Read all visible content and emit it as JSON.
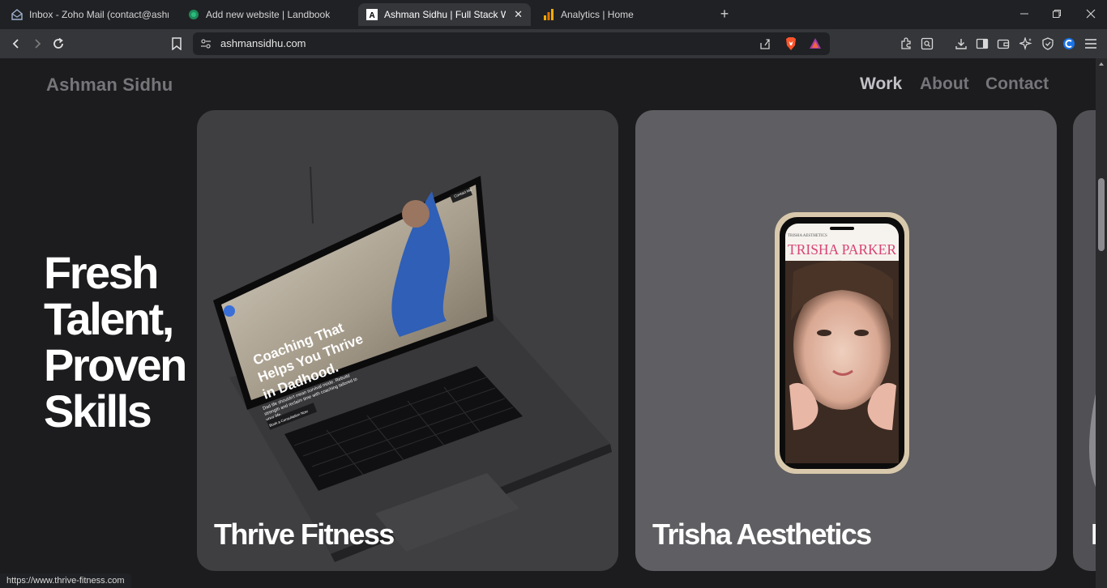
{
  "browser": {
    "tabs": [
      {
        "label": "Inbox - Zoho Mail (contact@ashmansidhu.com)",
        "icon": "mail-icon",
        "active": false
      },
      {
        "label": "Add new website | Landbook",
        "icon": "landbook-icon",
        "active": false
      },
      {
        "label": "Ashman Sidhu | Full Stack Web Developer",
        "icon": "site-a-icon",
        "active": true,
        "close": "✕"
      },
      {
        "label": "Analytics | Home",
        "icon": "analytics-icon",
        "active": false
      }
    ],
    "new_tab": "+",
    "address": "ashmansidhu.com",
    "status_url": "https://www.thrive-fitness.com"
  },
  "site": {
    "brand": "Ashman Sidhu",
    "nav": [
      {
        "label": "Work",
        "current": true
      },
      {
        "label": "About",
        "current": false
      },
      {
        "label": "Contact",
        "current": false
      }
    ],
    "hero": [
      "Fresh",
      "Talent,",
      "Proven",
      "Skills"
    ],
    "projects": [
      {
        "title": "Thrive Fitness",
        "mockup": {
          "contact_button": "Contact Me",
          "headline": [
            "Coaching That",
            "Helps You Thrive",
            "in Dadhood."
          ],
          "body": [
            "Dad life shouldn't mean survival mode. Rebuild",
            "strength and reclaim time with coaching tailored to",
            "your life."
          ],
          "cta": "Book a Consultation Now"
        }
      },
      {
        "title": "Trisha Aesthetics",
        "mockup": {
          "small_brand": "TRISHA AESTHETICS",
          "headline": "TRISHA PARKER"
        }
      },
      {
        "title": "I"
      }
    ]
  },
  "colors": {
    "accent_pink": "#d84476",
    "page_bg": "#1c1b1d"
  }
}
